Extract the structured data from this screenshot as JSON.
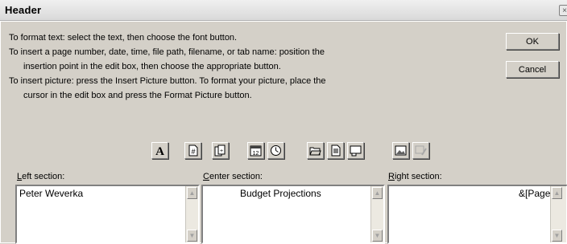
{
  "window": {
    "title": "Header",
    "close_glyph": "×"
  },
  "instructions": [
    "To format text:  select the text, then choose the font button.",
    "To insert a page number, date, time, file path, filename, or tab name:  position the",
    "insertion point in the edit box, then choose the appropriate button.",
    "To insert picture: press the Insert Picture button.  To format your picture, place the",
    "cursor in the edit box and press the Format Picture button."
  ],
  "buttons": {
    "ok": "OK",
    "cancel": "Cancel"
  },
  "toolbar": [
    {
      "name": "font",
      "icon": "font-icon"
    },
    {
      "name": "page-number",
      "icon": "page-number-icon"
    },
    {
      "name": "total-pages",
      "icon": "total-pages-icon"
    },
    {
      "name": "date",
      "icon": "date-icon"
    },
    {
      "name": "time",
      "icon": "time-icon"
    },
    {
      "name": "file-path",
      "icon": "file-path-icon"
    },
    {
      "name": "filename",
      "icon": "filename-icon"
    },
    {
      "name": "sheet-name",
      "icon": "sheet-name-icon"
    },
    {
      "name": "insert-picture",
      "icon": "insert-picture-icon"
    },
    {
      "name": "format-picture",
      "icon": "format-picture-icon",
      "disabled": true
    }
  ],
  "sections": {
    "left": {
      "label_key": "L",
      "label_rest": "eft section:",
      "text": "Peter Weverka"
    },
    "center": {
      "label_key": "C",
      "label_rest": "enter section:",
      "text": "Budget Projections"
    },
    "right": {
      "label_key": "R",
      "label_rest": "ight section:",
      "text": "&[Page]"
    }
  }
}
